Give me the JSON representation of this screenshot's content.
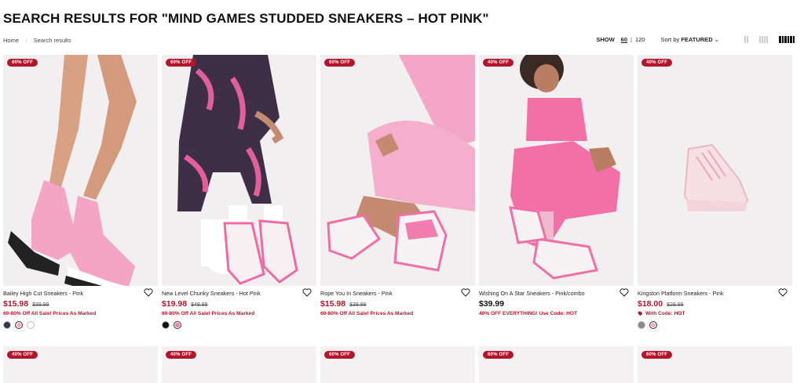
{
  "page_title": "SEARCH RESULTS FOR \"MIND GAMES STUDDED SNEAKERS – HOT PINK\"",
  "breadcrumb": {
    "home": "Home",
    "separator": "›",
    "current": "Search results"
  },
  "controls": {
    "show_label": "SHOW",
    "show_options": [
      "60",
      "120"
    ],
    "show_selected": "60",
    "pipe": "|",
    "sort_prefix": "Sort by ",
    "sort_value": "FEATURED",
    "sort_caret": "⌄",
    "grid_views": [
      "grid-view-2",
      "grid-view-3",
      "grid-view-4"
    ],
    "grid_active": "grid-view-4"
  },
  "colors": {
    "sale": "#b3152d",
    "pink": "#f4a7c4",
    "hot_pink": "#ec5d9b"
  },
  "products": [
    {
      "badge": "60% OFF",
      "name": "Bailey High Cut Sneakers - Pink",
      "price": "$15.98",
      "was": "$39.99",
      "promo": "60-80% Off All Sale! Prices As Marked",
      "swatches": [
        "#2d3a4e",
        "#f3a9c6",
        "#ffffff"
      ],
      "selected_swatch": 1
    },
    {
      "badge": "60% OFF",
      "name": "New Level Chunky Sneakers - Hot Pink",
      "price": "$19.98",
      "was": "$49.99",
      "promo": "60-80% Off All Sale! Prices As Marked",
      "swatches": [
        "#111111",
        "#f07cb0"
      ],
      "selected_swatch": 1
    },
    {
      "badge": "60% OFF",
      "name": "Rope You In Sneakers - Pink",
      "price": "$15.98",
      "was": "$39.99",
      "promo": "60-80% Off All Sale! Prices As Marked",
      "swatches": [],
      "selected_swatch": -1
    },
    {
      "badge": "40% OFF",
      "name": "Wishing On A Star Sneakers - Pink/combo",
      "price": "$39.99",
      "was": "",
      "promo": "40% OFF EVERYTHING! Use Code: HOT",
      "swatches": [],
      "selected_swatch": -1
    },
    {
      "badge": "40% OFF",
      "name": "Kingston Platform Sneakers - Pink",
      "price": "$18.00",
      "was": "$29.99",
      "promo": "With Code: HOT",
      "promo_icon": "tag-icon",
      "swatches": [
        "#8a8a8a",
        "#f3a9c6"
      ],
      "selected_swatch": 1
    }
  ],
  "row2_badges": [
    "40% OFF",
    "40% OFF",
    "60% OFF",
    "60% OFF",
    "60% OFF"
  ]
}
